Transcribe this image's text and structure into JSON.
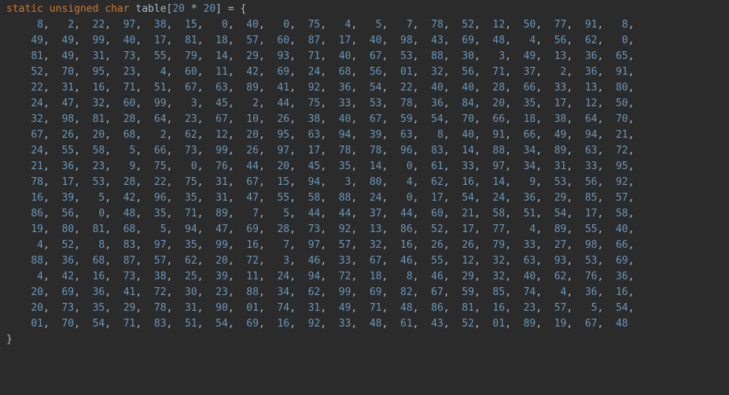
{
  "code": {
    "decl": {
      "kw_static": "static",
      "kw_unsigned": "unsigned",
      "kw_char": "char",
      "var_name": "table",
      "dim_a": "20",
      "dim_op": "*",
      "dim_b": "20"
    },
    "rows": [
      [
        8,
        2,
        22,
        97,
        38,
        15,
        0,
        40,
        0,
        75,
        4,
        5,
        7,
        78,
        52,
        12,
        50,
        77,
        91,
        8
      ],
      [
        49,
        49,
        99,
        40,
        17,
        81,
        18,
        57,
        60,
        87,
        17,
        40,
        98,
        43,
        69,
        48,
        4,
        56,
        62,
        0
      ],
      [
        81,
        49,
        31,
        73,
        55,
        79,
        14,
        29,
        93,
        71,
        40,
        67,
        53,
        88,
        30,
        3,
        49,
        13,
        36,
        65
      ],
      [
        52,
        70,
        95,
        23,
        4,
        60,
        11,
        42,
        69,
        24,
        68,
        56,
        "01",
        32,
        56,
        71,
        37,
        2,
        36,
        91
      ],
      [
        22,
        31,
        16,
        71,
        51,
        67,
        63,
        89,
        41,
        92,
        36,
        54,
        22,
        40,
        40,
        28,
        66,
        33,
        13,
        80
      ],
      [
        24,
        47,
        32,
        60,
        99,
        3,
        45,
        2,
        44,
        75,
        33,
        53,
        78,
        36,
        84,
        20,
        35,
        17,
        12,
        50
      ],
      [
        32,
        98,
        81,
        28,
        64,
        23,
        67,
        10,
        26,
        38,
        40,
        67,
        59,
        54,
        70,
        66,
        18,
        38,
        64,
        70
      ],
      [
        67,
        26,
        20,
        68,
        2,
        62,
        12,
        20,
        95,
        63,
        94,
        39,
        63,
        8,
        40,
        91,
        66,
        49,
        94,
        21
      ],
      [
        24,
        55,
        58,
        5,
        66,
        73,
        99,
        26,
        97,
        17,
        78,
        78,
        96,
        83,
        14,
        88,
        34,
        89,
        63,
        72
      ],
      [
        21,
        36,
        23,
        9,
        75,
        0,
        76,
        44,
        20,
        45,
        35,
        14,
        0,
        61,
        33,
        97,
        34,
        31,
        33,
        95
      ],
      [
        78,
        17,
        53,
        28,
        22,
        75,
        31,
        67,
        15,
        94,
        3,
        80,
        4,
        62,
        16,
        14,
        9,
        53,
        56,
        92
      ],
      [
        16,
        39,
        5,
        42,
        96,
        35,
        31,
        47,
        55,
        58,
        88,
        24,
        0,
        17,
        54,
        24,
        36,
        29,
        85,
        57
      ],
      [
        86,
        56,
        0,
        48,
        35,
        71,
        89,
        7,
        5,
        44,
        44,
        37,
        44,
        60,
        21,
        58,
        51,
        54,
        17,
        58
      ],
      [
        19,
        80,
        81,
        68,
        5,
        94,
        47,
        69,
        28,
        73,
        92,
        13,
        86,
        52,
        17,
        77,
        4,
        89,
        55,
        40
      ],
      [
        4,
        52,
        8,
        83,
        97,
        35,
        99,
        16,
        7,
        97,
        57,
        32,
        16,
        26,
        26,
        79,
        33,
        27,
        98,
        66
      ],
      [
        88,
        36,
        68,
        87,
        57,
        62,
        20,
        72,
        3,
        46,
        33,
        67,
        46,
        55,
        12,
        32,
        63,
        93,
        53,
        69
      ],
      [
        4,
        42,
        16,
        73,
        38,
        25,
        39,
        11,
        24,
        94,
        72,
        18,
        8,
        46,
        29,
        32,
        40,
        62,
        76,
        36
      ],
      [
        20,
        69,
        36,
        41,
        72,
        30,
        23,
        88,
        34,
        62,
        99,
        69,
        82,
        67,
        59,
        85,
        74,
        4,
        36,
        16
      ],
      [
        20,
        73,
        35,
        29,
        78,
        31,
        90,
        "01",
        74,
        31,
        49,
        71,
        48,
        86,
        81,
        16,
        23,
        57,
        5,
        54
      ],
      [
        "01",
        70,
        54,
        71,
        83,
        51,
        54,
        69,
        16,
        92,
        33,
        48,
        61,
        43,
        52,
        "01",
        89,
        19,
        67,
        48
      ]
    ]
  }
}
